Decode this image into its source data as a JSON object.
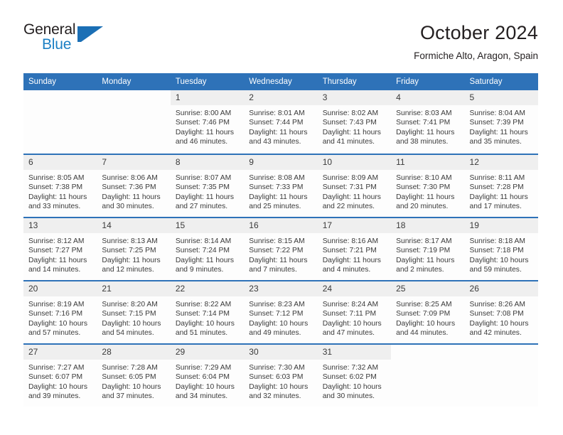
{
  "brand": {
    "name_part1": "General",
    "name_part2": "Blue",
    "flag_icon": "blue-flag-triangle-icon",
    "color_dark": "#231f20",
    "color_blue": "#1b7fc4"
  },
  "header": {
    "title": "October 2024",
    "subtitle": "Formiche Alto, Aragon, Spain"
  },
  "theme": {
    "header_blue": "#2e72b8",
    "daynum_band": "#efefef",
    "text": "#3a3a3a"
  },
  "calendar": {
    "weekdays": [
      "Sunday",
      "Monday",
      "Tuesday",
      "Wednesday",
      "Thursday",
      "Friday",
      "Saturday"
    ],
    "labels": {
      "sunrise": "Sunrise:",
      "sunset": "Sunset:",
      "daylight": "Daylight:"
    },
    "weeks": [
      [
        {
          "day": "",
          "blank": true
        },
        {
          "day": "",
          "blank": true
        },
        {
          "day": "1",
          "sunrise": "Sunrise: 8:00 AM",
          "sunset": "Sunset: 7:46 PM",
          "daylight": "Daylight: 11 hours and 46 minutes."
        },
        {
          "day": "2",
          "sunrise": "Sunrise: 8:01 AM",
          "sunset": "Sunset: 7:44 PM",
          "daylight": "Daylight: 11 hours and 43 minutes."
        },
        {
          "day": "3",
          "sunrise": "Sunrise: 8:02 AM",
          "sunset": "Sunset: 7:43 PM",
          "daylight": "Daylight: 11 hours and 41 minutes."
        },
        {
          "day": "4",
          "sunrise": "Sunrise: 8:03 AM",
          "sunset": "Sunset: 7:41 PM",
          "daylight": "Daylight: 11 hours and 38 minutes."
        },
        {
          "day": "5",
          "sunrise": "Sunrise: 8:04 AM",
          "sunset": "Sunset: 7:39 PM",
          "daylight": "Daylight: 11 hours and 35 minutes."
        }
      ],
      [
        {
          "day": "6",
          "sunrise": "Sunrise: 8:05 AM",
          "sunset": "Sunset: 7:38 PM",
          "daylight": "Daylight: 11 hours and 33 minutes."
        },
        {
          "day": "7",
          "sunrise": "Sunrise: 8:06 AM",
          "sunset": "Sunset: 7:36 PM",
          "daylight": "Daylight: 11 hours and 30 minutes."
        },
        {
          "day": "8",
          "sunrise": "Sunrise: 8:07 AM",
          "sunset": "Sunset: 7:35 PM",
          "daylight": "Daylight: 11 hours and 27 minutes."
        },
        {
          "day": "9",
          "sunrise": "Sunrise: 8:08 AM",
          "sunset": "Sunset: 7:33 PM",
          "daylight": "Daylight: 11 hours and 25 minutes."
        },
        {
          "day": "10",
          "sunrise": "Sunrise: 8:09 AM",
          "sunset": "Sunset: 7:31 PM",
          "daylight": "Daylight: 11 hours and 22 minutes."
        },
        {
          "day": "11",
          "sunrise": "Sunrise: 8:10 AM",
          "sunset": "Sunset: 7:30 PM",
          "daylight": "Daylight: 11 hours and 20 minutes."
        },
        {
          "day": "12",
          "sunrise": "Sunrise: 8:11 AM",
          "sunset": "Sunset: 7:28 PM",
          "daylight": "Daylight: 11 hours and 17 minutes."
        }
      ],
      [
        {
          "day": "13",
          "sunrise": "Sunrise: 8:12 AM",
          "sunset": "Sunset: 7:27 PM",
          "daylight": "Daylight: 11 hours and 14 minutes."
        },
        {
          "day": "14",
          "sunrise": "Sunrise: 8:13 AM",
          "sunset": "Sunset: 7:25 PM",
          "daylight": "Daylight: 11 hours and 12 minutes."
        },
        {
          "day": "15",
          "sunrise": "Sunrise: 8:14 AM",
          "sunset": "Sunset: 7:24 PM",
          "daylight": "Daylight: 11 hours and 9 minutes."
        },
        {
          "day": "16",
          "sunrise": "Sunrise: 8:15 AM",
          "sunset": "Sunset: 7:22 PM",
          "daylight": "Daylight: 11 hours and 7 minutes."
        },
        {
          "day": "17",
          "sunrise": "Sunrise: 8:16 AM",
          "sunset": "Sunset: 7:21 PM",
          "daylight": "Daylight: 11 hours and 4 minutes."
        },
        {
          "day": "18",
          "sunrise": "Sunrise: 8:17 AM",
          "sunset": "Sunset: 7:19 PM",
          "daylight": "Daylight: 11 hours and 2 minutes."
        },
        {
          "day": "19",
          "sunrise": "Sunrise: 8:18 AM",
          "sunset": "Sunset: 7:18 PM",
          "daylight": "Daylight: 10 hours and 59 minutes."
        }
      ],
      [
        {
          "day": "20",
          "sunrise": "Sunrise: 8:19 AM",
          "sunset": "Sunset: 7:16 PM",
          "daylight": "Daylight: 10 hours and 57 minutes."
        },
        {
          "day": "21",
          "sunrise": "Sunrise: 8:20 AM",
          "sunset": "Sunset: 7:15 PM",
          "daylight": "Daylight: 10 hours and 54 minutes."
        },
        {
          "day": "22",
          "sunrise": "Sunrise: 8:22 AM",
          "sunset": "Sunset: 7:14 PM",
          "daylight": "Daylight: 10 hours and 51 minutes."
        },
        {
          "day": "23",
          "sunrise": "Sunrise: 8:23 AM",
          "sunset": "Sunset: 7:12 PM",
          "daylight": "Daylight: 10 hours and 49 minutes."
        },
        {
          "day": "24",
          "sunrise": "Sunrise: 8:24 AM",
          "sunset": "Sunset: 7:11 PM",
          "daylight": "Daylight: 10 hours and 47 minutes."
        },
        {
          "day": "25",
          "sunrise": "Sunrise: 8:25 AM",
          "sunset": "Sunset: 7:09 PM",
          "daylight": "Daylight: 10 hours and 44 minutes."
        },
        {
          "day": "26",
          "sunrise": "Sunrise: 8:26 AM",
          "sunset": "Sunset: 7:08 PM",
          "daylight": "Daylight: 10 hours and 42 minutes."
        }
      ],
      [
        {
          "day": "27",
          "sunrise": "Sunrise: 7:27 AM",
          "sunset": "Sunset: 6:07 PM",
          "daylight": "Daylight: 10 hours and 39 minutes."
        },
        {
          "day": "28",
          "sunrise": "Sunrise: 7:28 AM",
          "sunset": "Sunset: 6:05 PM",
          "daylight": "Daylight: 10 hours and 37 minutes."
        },
        {
          "day": "29",
          "sunrise": "Sunrise: 7:29 AM",
          "sunset": "Sunset: 6:04 PM",
          "daylight": "Daylight: 10 hours and 34 minutes."
        },
        {
          "day": "30",
          "sunrise": "Sunrise: 7:30 AM",
          "sunset": "Sunset: 6:03 PM",
          "daylight": "Daylight: 10 hours and 32 minutes."
        },
        {
          "day": "31",
          "sunrise": "Sunrise: 7:32 AM",
          "sunset": "Sunset: 6:02 PM",
          "daylight": "Daylight: 10 hours and 30 minutes."
        },
        {
          "day": "",
          "blank": true,
          "trailing": true
        },
        {
          "day": "",
          "blank": true,
          "trailing": true
        }
      ]
    ]
  }
}
